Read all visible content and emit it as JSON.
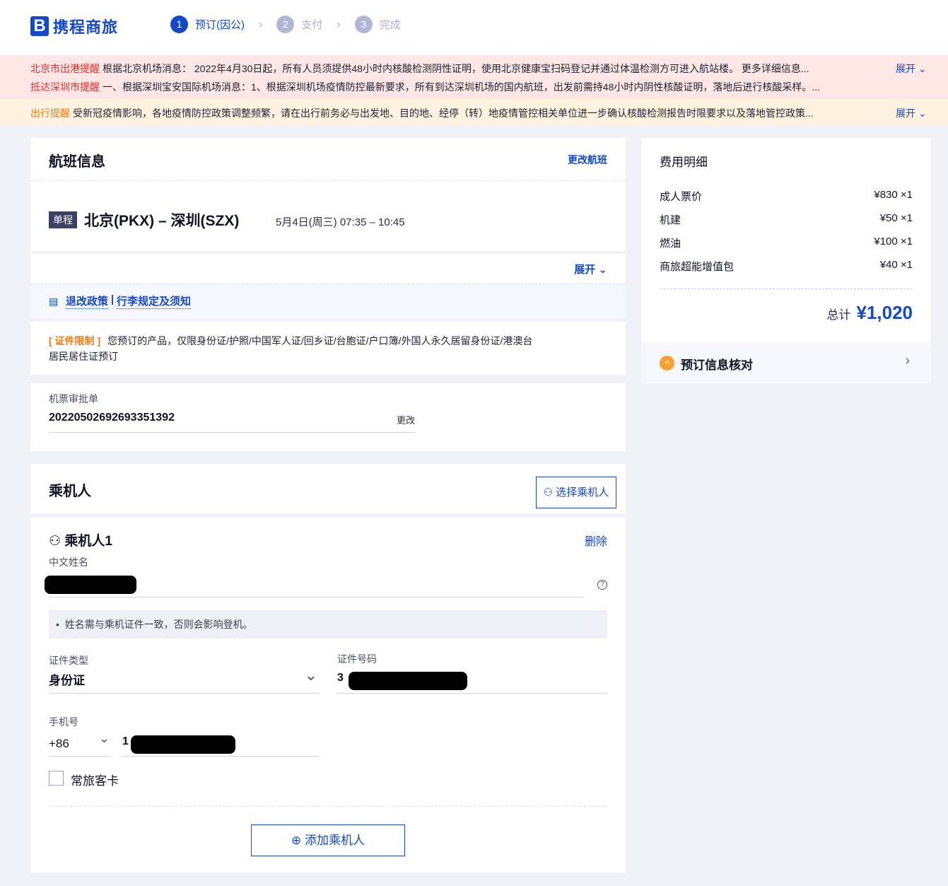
{
  "header": {
    "logo_mark": "B",
    "logo_text": "携程商旅",
    "steps": [
      {
        "num": "1",
        "label": "预订(因公)"
      },
      {
        "num": "2",
        "label": "支付"
      },
      {
        "num": "3",
        "label": "完成"
      }
    ]
  },
  "alerts": [
    {
      "title": "北京市出港提醒",
      "text": "根据北京机场消息： 2022年4月30日起，所有人员须提供48小时内核酸检测阴性证明，使用北京健康宝扫码登记并通过体温检测方可进入航站楼。 更多详细信息..."
    },
    {
      "title": "抵达深圳市提醒",
      "text": "一、根据深圳宝安国际机场消息：1、根据深圳机场疫情防控最新要求，所有到达深圳机场的国内航班，出发前需持48小时内阴性核酸证明，落地后进行核酸采样。..."
    },
    {
      "title": "出行提醒",
      "text": "受新冠疫情影响，各地疫情防控政策调整频繁，请在出行前务必与出发地、目的地、经停（转）地疫情管控相关单位进一步确认核酸检测报告时限要求以及落地管控政策..."
    }
  ],
  "expand_label": "展开",
  "flight": {
    "title": "航班信息",
    "change": "更改航班",
    "trip_type": "单程",
    "route": "北京(PKX) – 深圳(SZX)",
    "time": "5月4日(周三) 07:35 – 10:45",
    "expand": "展开",
    "policy1": "退改政策",
    "sep": "|",
    "policy2": "行李规定及须知"
  },
  "restriction": {
    "tag": "[ 证件限制 ]",
    "text": "您预订的产品，仅限身份证/护照/中国军人证/回乡证/台胞证/户口簿/外国人永久居留身份证/港澳台居民居住证预订"
  },
  "approval": {
    "label": "机票审批单",
    "value": "20220502692693351392",
    "change": "更改"
  },
  "passengers": {
    "title": "乘机人",
    "select": "选择乘机人",
    "p1": {
      "title": "乘机人1",
      "delete": "删除",
      "name_label": "中文姓名",
      "hint": "姓名需与乘机证件一致，否则会影响登机。",
      "id_type_label": "证件类型",
      "id_type": "身份证",
      "id_no_label": "证件号码",
      "id_no_prefix": "3",
      "phone_label": "手机号",
      "country_code": "+86",
      "phone_prefix": "1",
      "ff_card": "常旅客卡"
    },
    "add": "添加乘机人"
  },
  "fees": {
    "title": "费用明细",
    "items": [
      {
        "name": "成人票价",
        "value": "¥830 ×1"
      },
      {
        "name": "机建",
        "value": "¥50 ×1"
      },
      {
        "name": "燃油",
        "value": "¥100 ×1"
      },
      {
        "name": "商旅超能增值包",
        "value": "¥40 ×1"
      }
    ],
    "total_label": "总计",
    "total": "¥1,020",
    "verify": "预订信息核对"
  }
}
